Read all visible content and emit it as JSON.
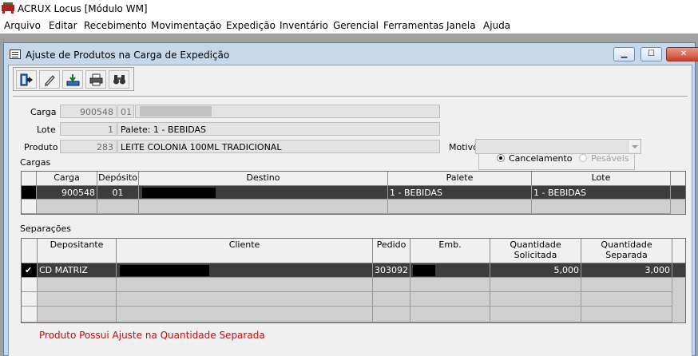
{
  "app": {
    "title": "ACRUX Locus [Módulo WM]"
  },
  "menu": [
    "Arquivo",
    "Editar",
    "Recebimento",
    "Movimentação",
    "Expedição",
    "Inventário",
    "Gerencial",
    "Ferramentas",
    "Janela",
    "Ajuda"
  ],
  "window": {
    "title": "Ajuste de Produtos na Carga de Expedição",
    "controls": {
      "minimize": "▁",
      "maximize": "☐",
      "close": "✕"
    }
  },
  "toolbar": {
    "buttons": [
      {
        "name": "exit-button",
        "icon": "exit-door-icon"
      },
      {
        "name": "edit-button",
        "icon": "pencil-icon"
      },
      {
        "name": "download-button",
        "icon": "download-tray-icon"
      },
      {
        "name": "print-button",
        "icon": "printer-icon"
      },
      {
        "name": "search-button",
        "icon": "binoculars-icon"
      }
    ]
  },
  "form": {
    "carga": {
      "label": "Carga",
      "code": "900548",
      "sub": "01",
      "desc": ""
    },
    "lote": {
      "label": "Lote",
      "code": "1",
      "desc": "Palete: 1 - BEBIDAS"
    },
    "produto": {
      "label": "Produto",
      "code": "283",
      "desc": "LEITE COLONIA 100ML TRADICIONAL"
    },
    "motivo": {
      "label": "Motivo",
      "value": ""
    },
    "options": {
      "cancelamento": "Cancelamento",
      "pesaveis": "Pesáveis",
      "selected": "cancelamento"
    }
  },
  "cargas": {
    "title": "Cargas",
    "columns": [
      "Carga",
      "Depósito",
      "Destino",
      "Palete",
      "Lote"
    ],
    "rows": [
      {
        "carga": "900548",
        "deposito": "01",
        "destino": "",
        "palete": "1 - BEBIDAS",
        "lote": "1 - BEBIDAS"
      }
    ]
  },
  "separacoes": {
    "title": "Separações",
    "columns": [
      "Depositante",
      "Cliente",
      "Pedido",
      "Emb.",
      "Quantidade\nSolicitada",
      "Quantidade\nSeparada"
    ],
    "rows": [
      {
        "check": "✔",
        "depositante": "CD MATRIZ",
        "cliente": "",
        "pedido": "303092",
        "emb": "",
        "qtd_solicitada": "5,000",
        "qtd_separada": "3,000"
      }
    ]
  },
  "warning": "Produto Possui Ajuste na Quantidade Separada"
}
